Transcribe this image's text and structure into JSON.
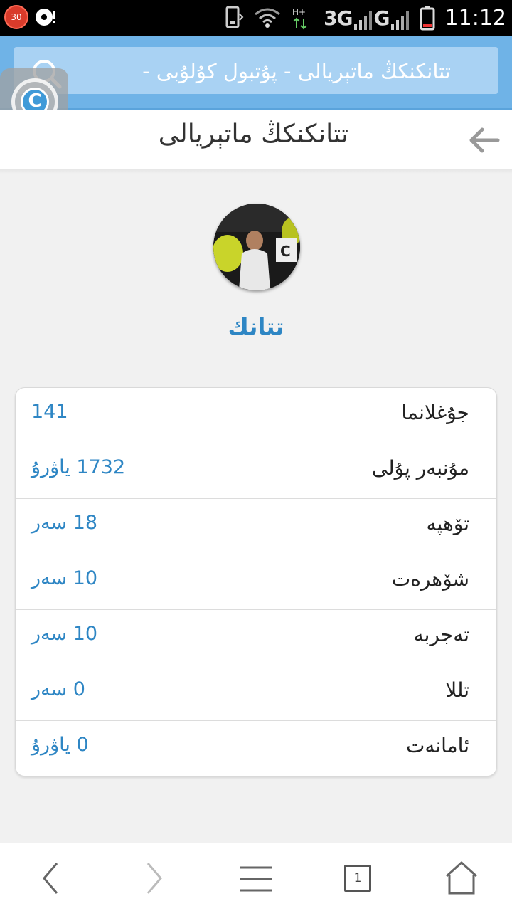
{
  "status_bar": {
    "notification_count": "30",
    "network_text": "3G",
    "network_text_2": "G",
    "time": "11:12"
  },
  "browser": {
    "address_text": "تتانكنكڭ ماتېريالى - پۇتبول كۇلۇبى -",
    "tab_count": "1"
  },
  "page": {
    "title": "تتانكنكڭ ماتېريالى"
  },
  "profile": {
    "username": "تتانك"
  },
  "stats": [
    {
      "label": "جۇغلانما",
      "value": "141"
    },
    {
      "label": "مۇنبەر پۇلى",
      "value": "1732 ياۋرۇ"
    },
    {
      "label": "تۆھپە",
      "value": "18 سەر"
    },
    {
      "label": "شۆھرەت",
      "value": "10 سەر"
    },
    {
      "label": "تەجربە",
      "value": "10 سەر"
    },
    {
      "label": "تللا",
      "value": "0 سەر"
    },
    {
      "label": "ئامانەت",
      "value": "0 ياۋرۇ"
    }
  ],
  "colors": {
    "accent": "#2e86c4",
    "address_bar": "#6fb3e7",
    "search_box": "#a9d2f3"
  },
  "icons": {
    "search": "search-icon",
    "back": "arrow-left-icon",
    "nav_back": "chevron-left-icon",
    "nav_forward": "chevron-right-icon",
    "menu": "hamburger-menu-icon",
    "home": "home-icon"
  }
}
